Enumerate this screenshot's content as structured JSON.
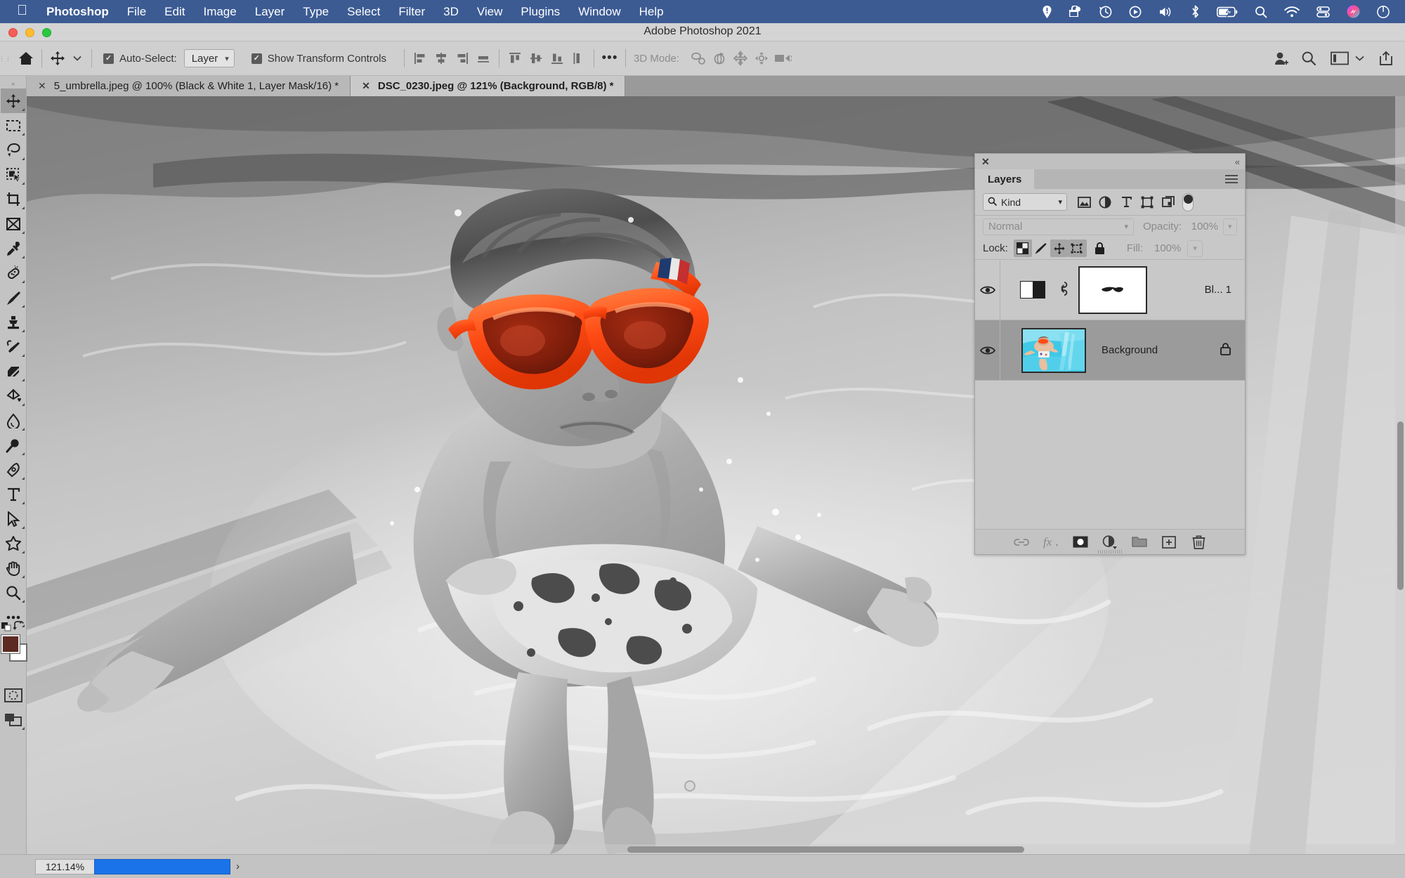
{
  "macos_menubar": {
    "apple_icon": "apple-icon",
    "menus": [
      {
        "label": "Photoshop",
        "bold": true
      },
      {
        "label": "File",
        "bold": false
      },
      {
        "label": "Edit",
        "bold": false
      },
      {
        "label": "Image",
        "bold": false
      },
      {
        "label": "Layer",
        "bold": false
      },
      {
        "label": "Type",
        "bold": false
      },
      {
        "label": "Select",
        "bold": false
      },
      {
        "label": "Filter",
        "bold": false
      },
      {
        "label": "3D",
        "bold": false
      },
      {
        "label": "View",
        "bold": false
      },
      {
        "label": "Plugins",
        "bold": false
      },
      {
        "label": "Window",
        "bold": false
      },
      {
        "label": "Help",
        "bold": false
      }
    ],
    "status_icons": [
      "location-pin-icon",
      "screen-lock-icon",
      "time-machine-icon",
      "play-circle-icon",
      "volume-icon",
      "bluetooth-icon",
      "battery-charging-icon",
      "spotlight-search-icon",
      "wifi-icon",
      "control-center-icon",
      "siri-icon",
      "notification-center-icon"
    ],
    "background_color": "#3c5b93"
  },
  "window": {
    "title": "Adobe Photoshop 2021",
    "traffic_lights": [
      "close",
      "minimize",
      "zoom"
    ],
    "colors": {
      "close": "#f45f57",
      "minimize": "#febc2e",
      "zoom": "#28c840"
    }
  },
  "options_bar": {
    "home_icon": "home-icon",
    "tool_icon": "move-tool-icon",
    "auto_select": {
      "label": "Auto-Select:",
      "checked": true,
      "value": "Layer"
    },
    "show_transform": {
      "label": "Show Transform Controls",
      "checked": true
    },
    "align_icons": [
      "align-left-edges-icon",
      "align-horizontal-centers-icon",
      "align-right-edges-icon",
      "distribute-horizontal-icon"
    ],
    "align_icons_2": [
      "align-top-edges-icon",
      "align-vertical-centers-icon",
      "align-bottom-edges-icon",
      "distribute-vertical-icon"
    ],
    "more_label": "•••",
    "mode_3d_label": "3D Mode:",
    "mode_3d_icons": [
      "rotate-3d-icon",
      "roll-3d-icon",
      "pan-3d-icon",
      "slide-3d-icon",
      "scale-3d-camera-icon"
    ],
    "right_icons": [
      "share-user-icon",
      "search-icon",
      "workspace-icon",
      "chevron-down-icon",
      "export-icon"
    ]
  },
  "document_tabs": [
    {
      "title": "5_umbrella.jpeg @ 100% (Black & White 1, Layer Mask/16) *",
      "active": false,
      "close_icon": "close-icon"
    },
    {
      "title": "DSC_0230.jpeg @ 121% (Background, RGB/8) *",
      "active": true,
      "close_icon": "close-icon"
    }
  ],
  "toolbar": {
    "tools": [
      {
        "name": "move-tool",
        "selected": true
      },
      {
        "name": "rectangular-marquee-tool",
        "selected": false
      },
      {
        "name": "lasso-tool",
        "selected": false
      },
      {
        "name": "object-selection-tool",
        "selected": false
      },
      {
        "name": "crop-tool",
        "selected": false
      },
      {
        "name": "frame-tool",
        "selected": false
      },
      {
        "name": "eyedropper-tool",
        "selected": false
      },
      {
        "name": "spot-healing-brush-tool",
        "selected": false
      },
      {
        "name": "brush-tool",
        "selected": false
      },
      {
        "name": "clone-stamp-tool",
        "selected": false
      },
      {
        "name": "history-brush-tool",
        "selected": false
      },
      {
        "name": "eraser-tool",
        "selected": false
      },
      {
        "name": "gradient-tool",
        "selected": false
      },
      {
        "name": "blur-tool",
        "selected": false
      },
      {
        "name": "dodge-tool",
        "selected": false
      },
      {
        "name": "pen-tool",
        "selected": false
      },
      {
        "name": "horizontal-type-tool",
        "selected": false
      },
      {
        "name": "path-selection-tool",
        "selected": false
      },
      {
        "name": "custom-shape-tool",
        "selected": false
      },
      {
        "name": "hand-tool",
        "selected": false
      },
      {
        "name": "zoom-tool",
        "selected": false
      },
      {
        "name": "edit-toolbar-tool",
        "selected": false
      }
    ],
    "foreground_color": "#5b2a21",
    "background_color": "#ffffff",
    "quick_mask_icon": "quick-mask-icon",
    "screen-mode-icon": "screen-mode-icon",
    "swap-colors-icon": "swap-colors-icon"
  },
  "layers_panel": {
    "close_icon": "close-icon",
    "collapse_icon": "collapse-panel-icon",
    "tab_label": "Layers",
    "menu_icon": "panel-menu-icon",
    "filter": {
      "search_icon": "search-icon",
      "kind_label": "Kind",
      "chevron": "chevron-down-icon",
      "type_filters": [
        "pixel-layer-filter-icon",
        "adjustment-layer-filter-icon",
        "type-layer-filter-icon",
        "shape-layer-filter-icon",
        "smart-object-filter-icon"
      ],
      "toggle_icon": "filter-toggle-switch"
    },
    "blend_mode": "Normal",
    "opacity_label": "Opacity:",
    "opacity_value": "100%",
    "lock_label": "Lock:",
    "lock_buttons": [
      {
        "name": "lock-transparent-pixels",
        "active": true
      },
      {
        "name": "lock-image-pixels",
        "active": false
      },
      {
        "name": "lock-position",
        "active": true
      },
      {
        "name": "lock-artboard-nesting",
        "active": true
      },
      {
        "name": "lock-all",
        "active": false
      }
    ],
    "fill_label": "Fill:",
    "fill_value": "100%",
    "layers": [
      {
        "name": "Bl... 1",
        "visible": true,
        "selected": false,
        "type": "adjustment",
        "adjustment_thumb": "black-and-white-adjustment-thumbnail",
        "link_icon": "link-mask-icon",
        "mask_thumb": "layer-mask-thumbnail",
        "locked": false
      },
      {
        "name": "Background",
        "visible": true,
        "selected": true,
        "type": "image",
        "thumbnail": "background-layer-thumbnail",
        "locked": true,
        "lock_icon": "lock-icon"
      }
    ],
    "bottom_buttons": [
      "link-layers-icon",
      "layer-style-fx-icon",
      "add-layer-mask-icon",
      "new-adjustment-layer-icon",
      "new-group-icon",
      "new-layer-icon",
      "delete-layer-icon"
    ]
  },
  "status_bar": {
    "zoom_level": "121.14%",
    "progress_arrow": "›",
    "progress_color": "#1a73e8"
  },
  "canvas": {
    "description": "Underwater black-and-white photograph of a boy swimming toward the camera, wearing orange sunglasses rendered in selective color",
    "accent_color": "#ff4a14",
    "zoom": "121%"
  }
}
